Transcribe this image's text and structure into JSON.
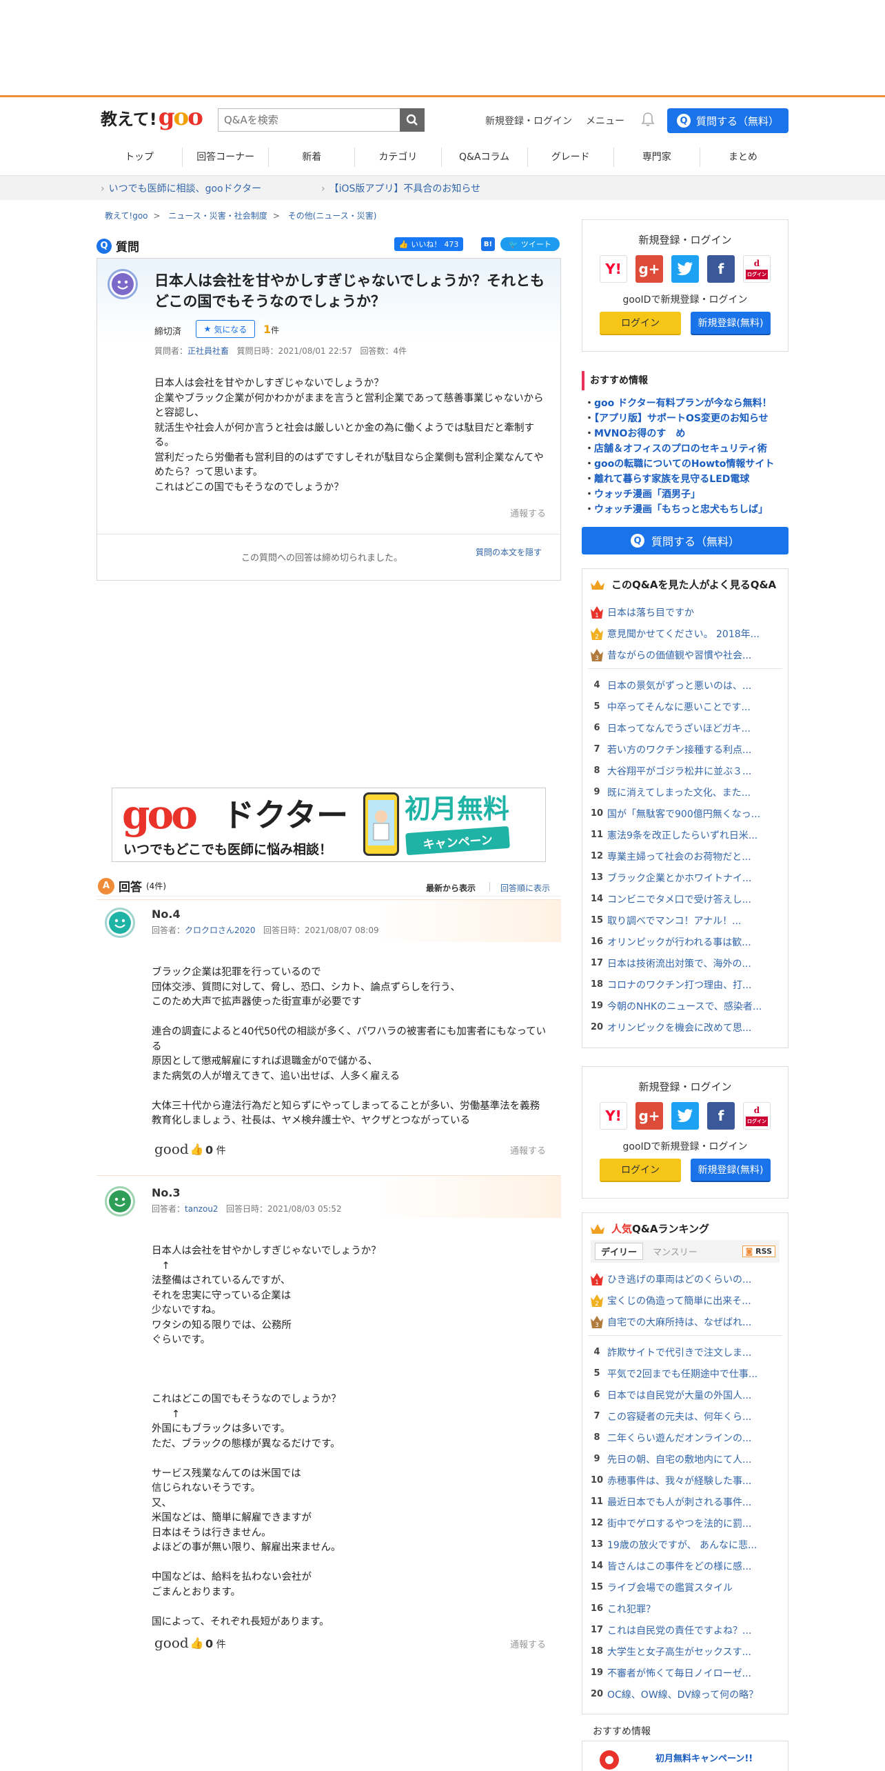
{
  "header": {
    "logo_text": "教えて!",
    "logo_goo": "goo",
    "search_placeholder": "Q&Aを検索",
    "signup_login": "新規登録・ログイン",
    "menu": "メニュー",
    "ask_button": "質問する（無料）"
  },
  "nav": [
    "トップ",
    "回答コーナー",
    "新着",
    "カテゴリ",
    "Q&Aコラム",
    "グレード",
    "専門家",
    "まとめ"
  ],
  "notices": [
    "いつでも医師に相談、gooドクター",
    "【iOS版アプリ】不具合のお知らせ"
  ],
  "breadcrumbs": [
    "教えて!goo",
    "ニュース・災害・社会制度",
    "その他(ニュース・災害)"
  ],
  "question": {
    "section_label": "質問",
    "badge": "Q",
    "like_label": "いいね！",
    "like_count": "473",
    "tweet_label": "ツイート",
    "hatena_label": "B!",
    "title": "日本人は会社を甘やかしすぎじゃないでしょうか？それともどこの国でもそうなのでしょうか？",
    "status": "締切済",
    "kininaru": "気になる",
    "kininaru_count": "1",
    "count_unit": "件",
    "asker_label": "質問者：",
    "asker": "正社員社畜",
    "date_label": "質問日時：",
    "date": "2021/08/01 22:57",
    "answer_count_label": "回答数：",
    "answer_count": "4件",
    "body": "日本人は会社を甘やかしすぎじゃないでしょうか？\n企業やブラック企業が何かわかがままを言うと営利企業であって慈善事業じゃないからと容認し、\n就活生や社会人が何か言うと社会は厳しいとか金の為に働くようでは駄目だと牽制する。\n営利だったら労働者も営利目的のはずですしそれが駄目なら企業側も営利企業なんてやめたら？って思います。\nこれはどこの国でもそうなのでしょうか？",
    "report": "通報する",
    "closed_message": "この質問への回答は締め切られました。",
    "hide_body": "質問の本文を隠す"
  },
  "ad": {
    "goo": "goo",
    "doctor": "ドクター",
    "sub": "いつでもどこでも医師に悩み相談！",
    "free": "初月無料",
    "campaign": "キャンペーン"
  },
  "answers_section": {
    "label": "回答",
    "badge": "A",
    "count": "(4件)",
    "sort_new": "最新から表示",
    "sort_old": "回答順に表示"
  },
  "answers": [
    {
      "no": "No.4",
      "answerer_label": "回答者：",
      "answerer": "クロクロさん2020",
      "date_label": "回答日時：",
      "date": "2021/08/07 08:09",
      "body": "ブラック企業は犯罪を行っているので\n団体交渉、質問に対して、脅し、恐口、シカト、論点ずらしを行う、\nこのため大声で拡声器使った街宣車が必要です\n\n連合の調査によると40代50代の相談が多く、パワハラの被害者にも加害者にもなっている\n原因として懲戒解雇にすれば退職金が0で儲かる、\nまた病気の人が増えてきて、追い出せば、人多く雇える\n\n大体三十代から違法行為だと知らずにやってしまってることが多い、労働基準法を義務教育化しましょう、社長は、ヤメ検弁護士や、ヤクザとつながっている",
      "good": "good",
      "good_count": "0",
      "good_unit": "件",
      "report": "通報する"
    },
    {
      "no": "No.3",
      "answerer_label": "回答者：",
      "answerer": "tanzou2",
      "date_label": "回答日時：",
      "date": "2021/08/03 05:52",
      "body": "日本人は会社を甘やかしすぎじゃないでしょうか？\n　↑\n法整備はされているんですが、\nそれを忠実に守っている企業は\n少ないですね。\nワタシの知る限りでは、公務所\nぐらいです。\n\n\n\nこれはどこの国でもそうなのでしょうか？\n　　↑\n外国にもブラックは多いです。\nただ、ブラックの態様が異なるだけです。\n\nサービス残業なんてのは米国では\n信じられないそうです。\n又、\n米国などは、簡単に解雇できますが\n日本はそうは行きません。\nよほどの事が無い限り、解雇出来ません。\n\n中国などは、給料を払わない会社が\nごまんとおります。\n\n国によって、それぞれ長短があります。",
      "good": "good",
      "good_count": "0",
      "good_unit": "件",
      "report": "通報する"
    }
  ],
  "sidebar": {
    "login_box": {
      "title": "新規登録・ログイン",
      "gooid": "gooIDで新規登録・ログイン",
      "login": "ログイン",
      "register": "新規登録(無料)",
      "social": [
        "Y!",
        "g+",
        "twitter",
        "f",
        "d"
      ],
      "docomo_label": "ログイン"
    },
    "recommend_title": "おすすめ情報",
    "recommend": [
      "goo ドクター有料プランが今なら無料！",
      "【アプリ版】サポートOS変更のお知らせ",
      "MVNOお得のす　め",
      "店舗＆オフィスのプロのセキュリティ術",
      "gooの転職についてのHowto情報サイト",
      "離れて暮らす家族を見守るLED電球",
      "ウォッチ漫画「酒男子」",
      "ウォッチ漫画「もちっと忠犬もちしば」"
    ],
    "ask_button": "質問する（無料）",
    "related_title": "このQ&Aを見た人がよく見るQ&A",
    "related": [
      "日本は落ち目ですか",
      "意見聞かせてください。 2018年...",
      "昔ながらの価値観や習慣や社会...",
      "日本の景気がずっと悪いのは、...",
      "中卒ってそんなに悪いことです...",
      "日本ってなんでうざいほどガキ...",
      "若い方のワクチン接種する利点...",
      "大谷翔平がゴジラ松井に並ぶ３...",
      "既に消えてしまった文化、また...",
      "国が「無駄客で900億円無くなっ...",
      "憲法9条を改正したらいずれ日米...",
      "専業主婦って社会のお荷物だと...",
      "ブラック企業とかホワイトナイ...",
      "コンビニでタメ口で受け答えし...",
      "取り調べでマンコ！アナル！...",
      "オリンピックが行われる事は歓...",
      "日本は技術流出対策で、海外の...",
      "コロナのワクチン打つ理由、打...",
      "今朝のNHKのニュースで、感染者...",
      "オリンピックを機会に改めて思..."
    ],
    "ranking_title_hot": "人気",
    "ranking_title_rest": "Q&Aランキング",
    "tab_daily": "デイリー",
    "tab_monthly": "マンスリー",
    "rss": "RSS",
    "ranking": [
      "ひき逃げの車両はどのくらいの...",
      "宝くじの偽造って簡単に出来そ...",
      "自宅での大麻所持は、なぜばれ...",
      "詐欺サイトで代引きで注文しま...",
      "平気で2回までも任期途中で仕事...",
      "日本では自民党が大量の外国人...",
      "この容疑者の元夫は、何年くら...",
      "二年くらい遊んだオンラインの...",
      "先日の朝、自宅の敷地内にて人...",
      "赤穂事件は、我々が経験した事...",
      "最近日本でも人が刺される事件...",
      "街中でゲロするやつを法的に罰...",
      "19歳の放火ですが、 あんなに悲...",
      "皆さんはこの事件をどの様に感...",
      "ライブ会場での鑑賞スタイル",
      "これ犯罪？",
      "これは自民党の責任ですよね？...",
      "大学生と女子高生がセックスす...",
      "不審者が怖くて毎日ノイローゼ...",
      "OC線、OW線、DV線って何の略？"
    ],
    "footer_recommend": "おすすめ情報",
    "campaign_text": "初月無料キャンペーン!!"
  },
  "colors": {
    "accent": "#f08c38",
    "primary": "#1a73e8",
    "link": "#3366aa"
  }
}
